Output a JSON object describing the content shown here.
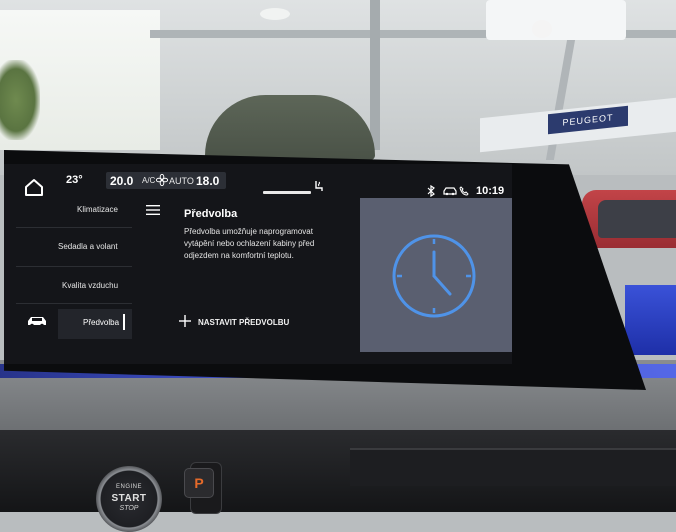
{
  "status_bar": {
    "outside_temp": "23°",
    "driver_temp": "20.0",
    "ac_label": "A/C",
    "auto_label": "AUTO",
    "passenger_temp": "18.0",
    "clock": "10:19"
  },
  "menu": {
    "items": [
      {
        "label": "Klimatizace"
      },
      {
        "label": "Sedadla a volant"
      },
      {
        "label": "Kvalita vzduchu"
      },
      {
        "label": "Předvolba"
      }
    ],
    "active_index": 3
  },
  "content": {
    "title": "Předvolba",
    "description": "Předvolba umožňuje naprogramovat vytápění nebo ochlazení kabiny před odjezdem na komfortní teplotu.",
    "add_button_label": "NASTAVIT PŘEDVOLBU"
  },
  "showroom": {
    "sign_text": "PEUGEOT"
  },
  "dashboard": {
    "parking_label": "P",
    "start_button": {
      "line1": "ENGINE",
      "line2": "START",
      "line3": "STOP"
    }
  },
  "icons": {
    "home": "home-icon",
    "fan": "fan-icon",
    "seat_heat": "seat-heat-icon",
    "bluetooth": "bluetooth-icon",
    "car_status": "car-status-icon",
    "phone": "phone-icon",
    "vehicle": "car-icon",
    "menu": "hamburger-icon",
    "add": "plus-icon",
    "clock": "clock-icon"
  },
  "colors": {
    "screen_bg": "#141519",
    "panel_bg": "#5a5f70",
    "clock_accent": "#4f93e8",
    "text_primary": "#ffffff",
    "ambient_blue": "#3a4ed8"
  }
}
